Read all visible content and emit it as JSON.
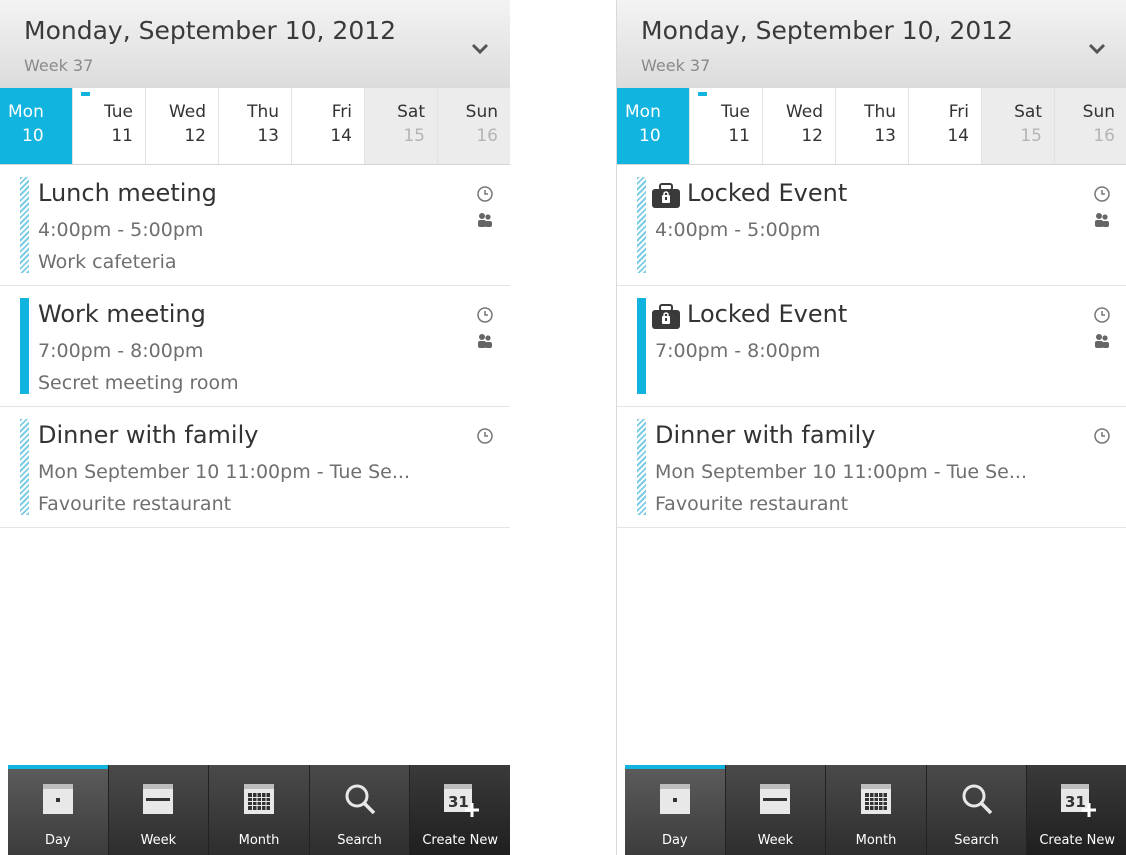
{
  "phones": [
    {
      "date_title": "Monday, September 10, 2012",
      "week_label": "Week 37",
      "days": [
        {
          "name": "Mon",
          "num": "10"
        },
        {
          "name": "Tue",
          "num": "11"
        },
        {
          "name": "Wed",
          "num": "12"
        },
        {
          "name": "Thu",
          "num": "13"
        },
        {
          "name": "Fri",
          "num": "14"
        },
        {
          "name": "Sat",
          "num": "15"
        },
        {
          "name": "Sun",
          "num": "16"
        }
      ],
      "events": [
        {
          "title": "Lunch meeting",
          "time": "4:00pm - 5:00pm",
          "location": "Work cafeteria"
        },
        {
          "title": "Work meeting",
          "time": "7:00pm - 8:00pm",
          "location": "Secret meeting room"
        },
        {
          "title": "Dinner with family",
          "time": "Mon September 10 11:00pm - Tue Se...",
          "location": "Favourite restaurant"
        }
      ]
    },
    {
      "date_title": "Monday, September 10, 2012",
      "week_label": "Week 37",
      "days": [
        {
          "name": "Mon",
          "num": "10"
        },
        {
          "name": "Tue",
          "num": "11"
        },
        {
          "name": "Wed",
          "num": "12"
        },
        {
          "name": "Thu",
          "num": "13"
        },
        {
          "name": "Fri",
          "num": "14"
        },
        {
          "name": "Sat",
          "num": "15"
        },
        {
          "name": "Sun",
          "num": "16"
        }
      ],
      "events": [
        {
          "title": "Locked Event",
          "time": "4:00pm - 5:00pm",
          "location": ""
        },
        {
          "title": "Locked Event",
          "time": "7:00pm - 8:00pm",
          "location": ""
        },
        {
          "title": "Dinner with family",
          "time": "Mon September 10 11:00pm - Tue Se...",
          "location": "Favourite restaurant"
        }
      ]
    }
  ],
  "tabs": [
    {
      "label": "Day",
      "icon": "day-calendar-icon"
    },
    {
      "label": "Week",
      "icon": "week-calendar-icon"
    },
    {
      "label": "Month",
      "icon": "month-calendar-icon"
    },
    {
      "label": "Search",
      "icon": "search-icon"
    },
    {
      "label": "Create New",
      "icon": "create-event-icon",
      "icon_text": "31"
    }
  ],
  "colors": {
    "accent": "#11b3df",
    "bottom_bar": "#333333"
  }
}
